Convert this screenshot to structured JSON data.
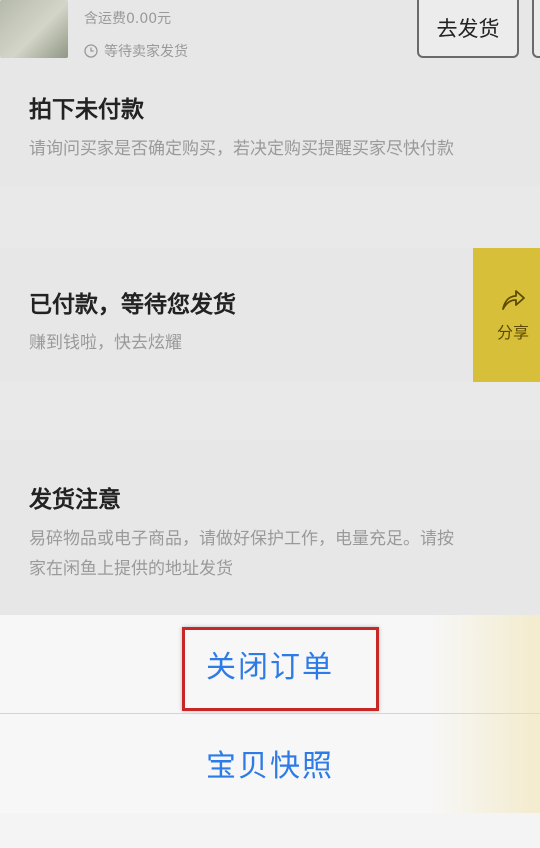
{
  "order": {
    "shipping_fee": "含运费0.00元",
    "status_wait": "等待卖家发货",
    "ship_button": "去发货"
  },
  "cards": [
    {
      "title": "拍下未付款",
      "lines": [
        "请询问买家是否确定购买，若决定购买提醒买家尽快付款"
      ]
    },
    {
      "title": "已付款，等待您发货",
      "lines": [
        "赚到钱啦，快去炫耀"
      ]
    },
    {
      "title": "发货注意",
      "lines": [
        "易碎物品或电子商品，请做好保护工作，电量充足。请按",
        "家在闲鱼上提供的地址发货"
      ]
    }
  ],
  "share": {
    "label": "分享",
    "icon": "share-arrow-icon",
    "color": "#d8bf3a"
  },
  "action_sheet": {
    "close_order": "关闭订单",
    "snapshot": "宝贝快照",
    "text_color": "#2d7be6",
    "highlight_color": "#c62828"
  }
}
